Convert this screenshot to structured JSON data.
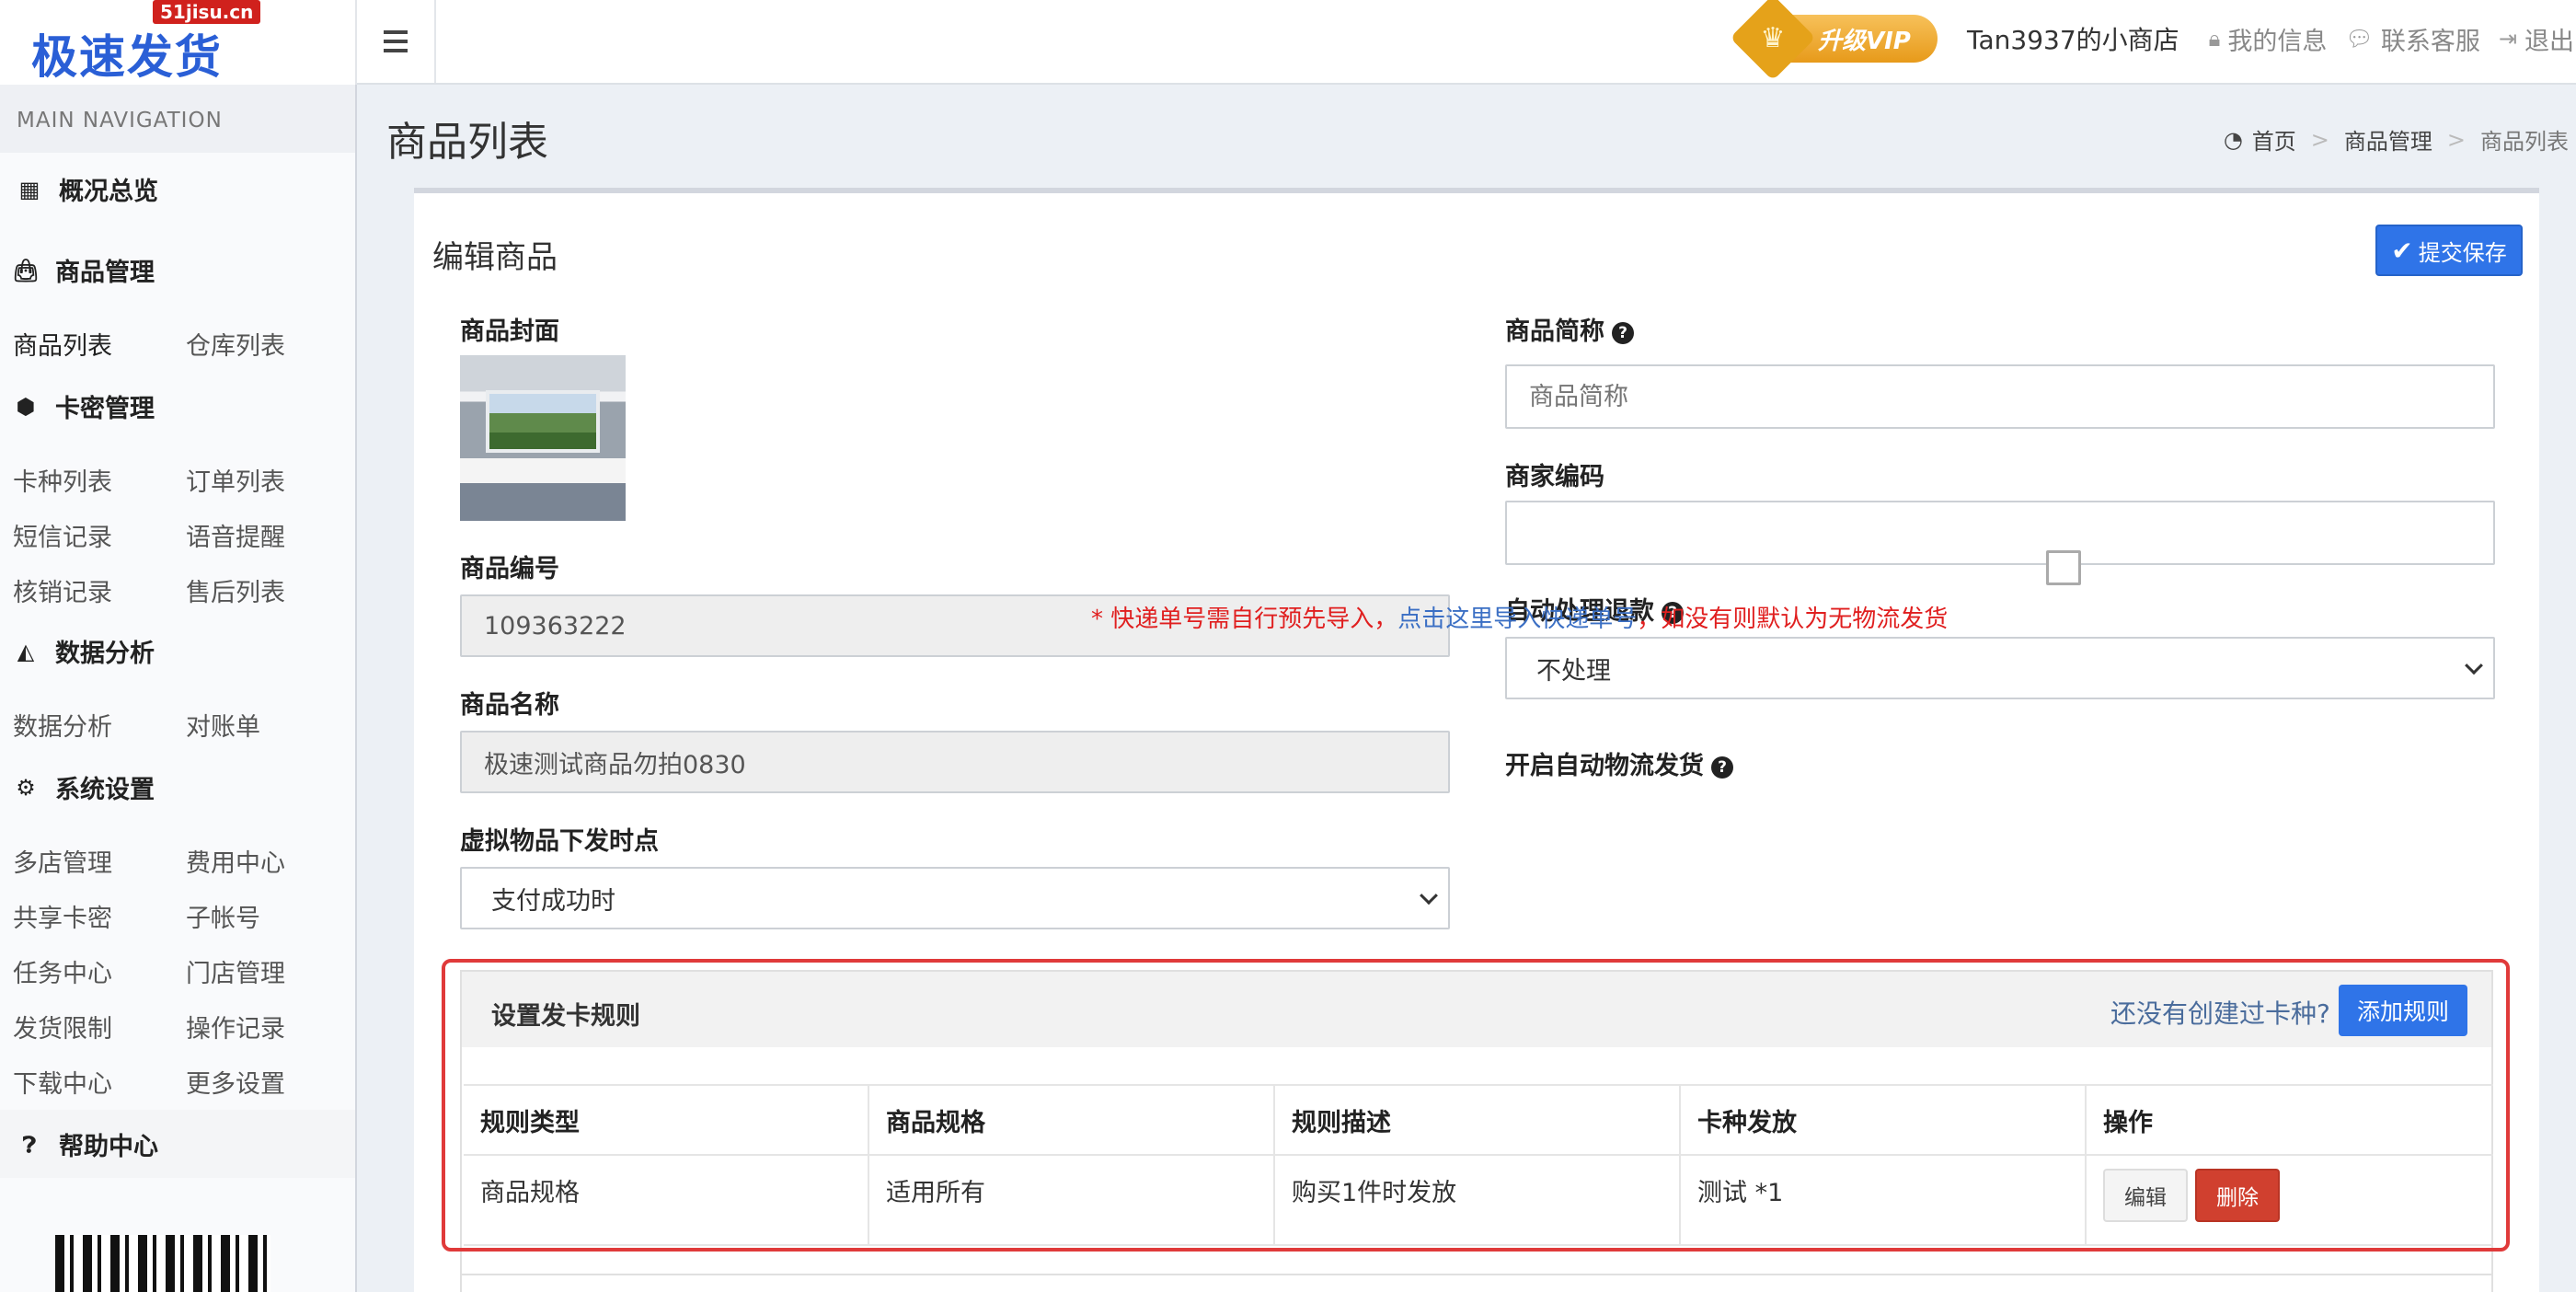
{
  "brand": {
    "name": "极速发货",
    "badge": "51jisu.cn"
  },
  "header": {
    "vip_label": "升级VIP",
    "shop_name": "Tan3937的小商店",
    "my_info": "我的信息",
    "contact": "联系客服",
    "logout": "退出"
  },
  "sidebar": {
    "heading": "MAIN NAVIGATION",
    "overview": "概况总览",
    "goods": {
      "title": "商品管理",
      "items": [
        "商品列表",
        "仓库列表"
      ]
    },
    "cards": {
      "title": "卡密管理",
      "items": [
        "卡种列表",
        "订单列表",
        "短信记录",
        "语音提醒",
        "核销记录",
        "售后列表"
      ]
    },
    "analytics": {
      "title": "数据分析",
      "items": [
        "数据分析",
        "对账单"
      ]
    },
    "settings": {
      "title": "系统设置",
      "items": [
        "多店管理",
        "费用中心",
        "共享卡密",
        "子帐号",
        "任务中心",
        "门店管理",
        "发货限制",
        "操作记录",
        "下载中心",
        "更多设置"
      ]
    },
    "help": "帮助中心"
  },
  "page": {
    "title": "商品列表",
    "breadcrumb": [
      "首页",
      "商品管理",
      "商品列表"
    ]
  },
  "form": {
    "box_title": "编辑商品",
    "save_label": "提交保存",
    "cover_label": "商品封面",
    "code_label": "商品编号",
    "code_value": "109363222",
    "name_label": "商品名称",
    "name_value": "极速测试商品勿拍0830",
    "send_time_label": "虚拟物品下发时点",
    "send_time_value": "支付成功时",
    "short_name_label": "商品简称",
    "short_name_placeholder": "商品简称",
    "merchant_code_label": "商家编码",
    "merchant_code_value": "",
    "refund_label": "自动处理退款",
    "refund_value": "不处理",
    "auto_ship_label": "开启自动物流发货",
    "auto_ship_checked": false,
    "note_prefix": "* 快递单号需自行预先导入，",
    "note_link": "点击这里导入快递单号",
    "note_suffix": "，如没有则默认为无物流发货"
  },
  "rules": {
    "title": "设置发卡规则",
    "hint": "还没有创建过卡种?",
    "add_label": "添加规则",
    "columns": [
      "规则类型",
      "商品规格",
      "规则描述",
      "卡种发放",
      "操作"
    ],
    "rows": [
      {
        "type": "商品规格",
        "spec": "适用所有",
        "desc": "购买1件时发放",
        "card": "测试 *1",
        "edit": "编辑",
        "delete": "删除"
      }
    ]
  },
  "colors": {
    "primary": "#2f74e8",
    "danger": "#d0402f",
    "note_red": "#e01f1f",
    "highlight_border": "#e03a3a"
  }
}
